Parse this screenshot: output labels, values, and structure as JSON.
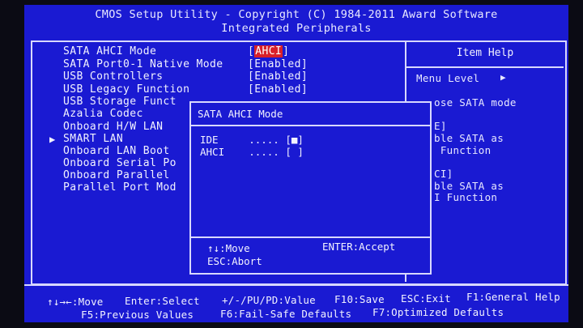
{
  "header": {
    "title": "CMOS Setup Utility - Copyright (C) 1984-2011 Award Software",
    "subtitle": "Integrated Peripherals"
  },
  "menu": {
    "items": [
      {
        "label": "SATA AHCI Mode",
        "value": "[AHCI]"
      },
      {
        "label": "SATA Port0-1 Native Mode",
        "value": "[Enabled]"
      },
      {
        "label": "USB Controllers",
        "value": "[Enabled]"
      },
      {
        "label": "USB Legacy Function",
        "value": "[Enabled]"
      },
      {
        "label": "USB Storage Funct"
      },
      {
        "label": "Azalia Codec"
      },
      {
        "label": "Onboard H/W LAN"
      },
      {
        "label": "SMART LAN",
        "submenu_arrow": "▶"
      },
      {
        "label": "Onboard LAN Boot"
      },
      {
        "label": "Onboard Serial Po"
      },
      {
        "label": "Onboard Parallel"
      },
      {
        "label": "Parallel Port Mod"
      }
    ]
  },
  "help": {
    "title": "Item Help",
    "menu_level": "Menu Level",
    "menu_level_arrow": "▶",
    "lines": [
      "ose SATA mode",
      "E]",
      "ble SATA as",
      " Function",
      "CI]",
      "ble SATA as",
      "I Function"
    ]
  },
  "popup": {
    "title": "SATA AHCI Mode",
    "options": [
      {
        "label": "IDE     .....",
        "mark": "[■]"
      },
      {
        "label": "AHCI    .....",
        "mark": "[ ]"
      }
    ],
    "keys": {
      "move": "↑↓:Move",
      "accept": "ENTER:Accept",
      "abort": "ESC:Abort"
    }
  },
  "footer": {
    "row1": [
      "↑↓→←:Move",
      "Enter:Select",
      "+/-/PU/PD:Value",
      "F10:Save",
      "ESC:Exit",
      "F1:General Help"
    ],
    "row2": [
      "F5:Previous Values",
      "F6:Fail-Safe Defaults",
      "F7:Optimized Defaults"
    ]
  },
  "colors": {
    "background": "#1a1ad2",
    "frame": "#d8d8ff",
    "text": "#f2f2ff",
    "highlight": "#d8202a"
  }
}
